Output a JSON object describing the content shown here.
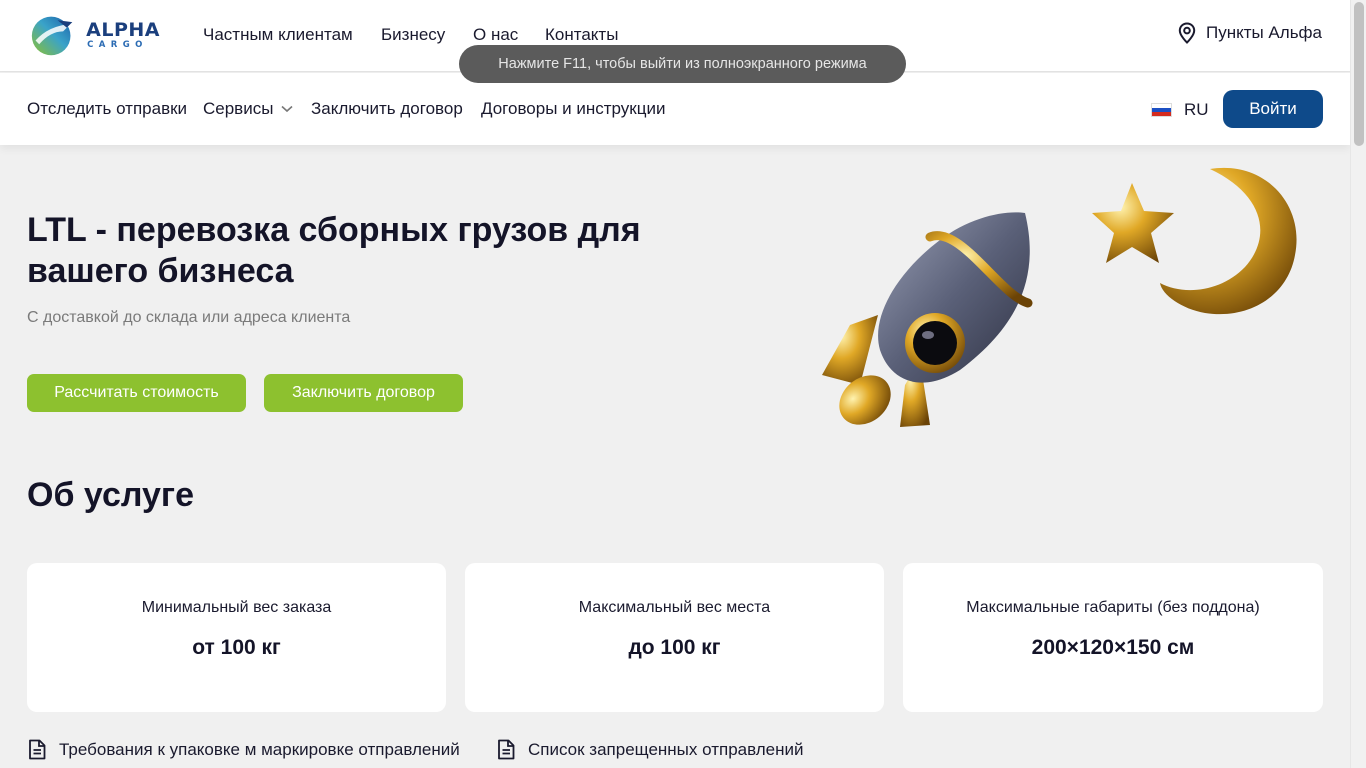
{
  "logo": {
    "word1": "ALPHA",
    "word2": "CARGO"
  },
  "topnav": {
    "items": [
      "Частным клиентам",
      "Бизнесу",
      "О нас",
      "Контакты"
    ],
    "points_label": "Пункты Альфа"
  },
  "fullscreen_toast": "Нажмите F11, чтобы выйти из полноэкранного режима",
  "subnav": {
    "items": [
      "Отследить отправки",
      "Сервисы",
      "Заключить договор",
      "Договоры и инструкции"
    ],
    "lang": "RU",
    "login": "Войти"
  },
  "hero": {
    "title": "LTL - перевозка сборных грузов для вашего бизнеса",
    "subtitle": "С доставкой до склада или адреса клиента",
    "btn_calc": "Рассчитать стоимость",
    "btn_contract": "Заключить договор"
  },
  "about": {
    "title": "Об услуге",
    "cards": [
      {
        "label": "Минимальный вес заказа",
        "value": "от 100 кг"
      },
      {
        "label": "Максимальный вес места",
        "value": "до 100 кг"
      },
      {
        "label": "Максимальные габариты (без поддона)",
        "value": "200×120×150 см"
      }
    ],
    "links": [
      "Требования к упаковке м маркировке отправлений",
      "Список запрещенных отправлений"
    ]
  },
  "colors": {
    "brand_blue": "#0e4a8a",
    "accent_green": "#8dc12f",
    "background": "#f0f0f0"
  },
  "icons": [
    "location-pin-icon",
    "chevron-down-icon",
    "russia-flag-icon",
    "document-icon",
    "rocket-illustration",
    "star-illustration",
    "moon-illustration"
  ]
}
